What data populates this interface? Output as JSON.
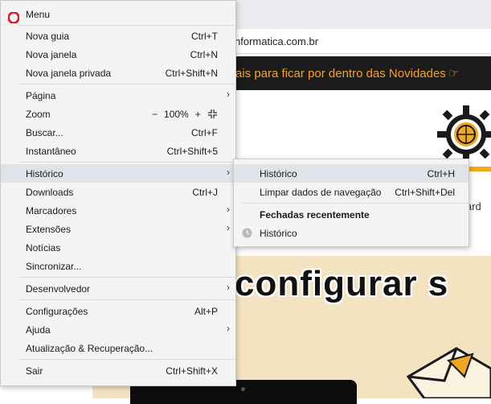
{
  "background": {
    "url_fragment": "nformatica.com.br",
    "banner_text": "ais para ficar por dentro das Novidades",
    "banner_icon": "hand-pointing-right-icon",
    "site_partial": "ard",
    "headline": "configurar s",
    "colors": {
      "banner_bg": "#1b1b1b",
      "banner_text": "#f7a21b",
      "article_bg": "#f4e3c1"
    }
  },
  "main_menu": {
    "title": "Menu",
    "logo_color": "#e0151f",
    "items": {
      "nova_guia": {
        "label": "Nova guia",
        "shortcut": "Ctrl+T"
      },
      "nova_janela": {
        "label": "Nova janela",
        "shortcut": "Ctrl+N"
      },
      "nova_janela_privada": {
        "label": "Nova janela privada",
        "shortcut": "Ctrl+Shift+N"
      },
      "pagina": {
        "label": "Página"
      },
      "zoom": {
        "label": "Zoom",
        "minus": "−",
        "value": "100%",
        "plus": "+"
      },
      "buscar": {
        "label": "Buscar...",
        "shortcut": "Ctrl+F"
      },
      "instantaneo": {
        "label": "Instantâneo",
        "shortcut": "Ctrl+Shift+5"
      },
      "historico": {
        "label": "Histórico"
      },
      "downloads": {
        "label": "Downloads",
        "shortcut": "Ctrl+J"
      },
      "marcadores": {
        "label": "Marcadores"
      },
      "extensoes": {
        "label": "Extensões"
      },
      "noticias": {
        "label": "Notícias"
      },
      "sincronizar": {
        "label": "Sincronizar..."
      },
      "desenvolvedor": {
        "label": "Desenvolvedor"
      },
      "configuracoes": {
        "label": "Configurações",
        "shortcut": "Alt+P"
      },
      "ajuda": {
        "label": "Ajuda"
      },
      "atualizacao": {
        "label": "Atualização & Recuperação..."
      },
      "sair": {
        "label": "Sair",
        "shortcut": "Ctrl+Shift+X"
      }
    }
  },
  "history_submenu": {
    "historico": {
      "label": "Histórico",
      "shortcut": "Ctrl+H"
    },
    "limpar": {
      "label": "Limpar dados de navegação",
      "shortcut": "Ctrl+Shift+Del"
    },
    "recent_header": "Fechadas recentemente",
    "recent_items": [
      {
        "label": "Histórico",
        "icon": "clock-icon"
      }
    ]
  }
}
